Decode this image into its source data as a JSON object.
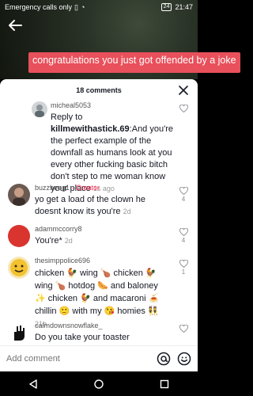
{
  "status_bar": {
    "left_text": "Emergency calls only",
    "battery": "24",
    "time": "21:47"
  },
  "video": {
    "caption": "congratulations you just got offended by a joke"
  },
  "sheet": {
    "title": "18 comments"
  },
  "comments": [
    {
      "username": "micheal5053",
      "reply_prefix": "Reply to ",
      "mention": "killmewithastick.69",
      "text": ":And you're the perfect example of the downfall as humans look at you every other fucking basic bitch don't step to me woman know your place",
      "time": "1s ago",
      "likes": ""
    },
    {
      "username": "buzzbeeg1",
      "creator_label": " · Creator",
      "text": "yo get a load of the clown he doesnt know its you're",
      "time": "2d",
      "likes": "4"
    },
    {
      "username": "adammccorry8",
      "text": "You're*",
      "time": "2d",
      "likes": "4"
    },
    {
      "username": "thesimppolice696",
      "text": "chicken 🐓 wing 🍗 chicken 🐓 wing 🍗 hotdog 🌭 and baloney ✨ chicken 🐓 and macaroni 🍝 chillin 🙂 with my 😘 homies 👯",
      "time": "21h",
      "likes": "1"
    },
    {
      "username": "calmdownsnowflake_",
      "text": "Do you take your toaster everywhere",
      "time": "",
      "likes": ""
    }
  ],
  "add_comment": {
    "placeholder": "Add comment"
  },
  "icons": {
    "back": "arrow-left-icon",
    "close": "close-icon",
    "like": "heart-outline-icon",
    "mention": "at-sign-icon",
    "emoji": "smiley-icon"
  },
  "colors": {
    "creator": "#fe2c55",
    "caption_bg": "#e8505b"
  }
}
